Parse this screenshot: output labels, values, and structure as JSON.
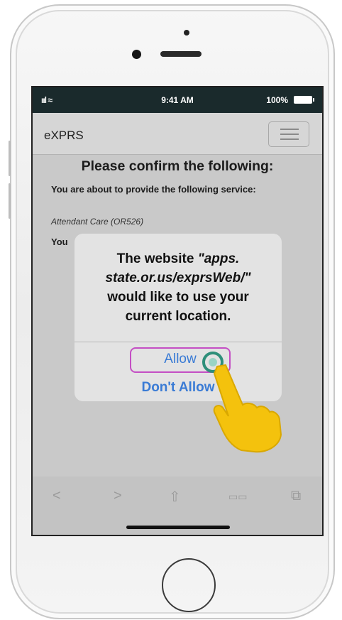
{
  "status_bar": {
    "signal": "ııl ≈",
    "time": "9:41 AM",
    "battery": "100%"
  },
  "navbar": {
    "brand": "eXPRS"
  },
  "page": {
    "title": "Please confirm the following:",
    "intro": "You are about to provide the following service:",
    "service": "Attendant Care (OR526)",
    "second_line_start": "You"
  },
  "dialog": {
    "message_1": "The website ",
    "message_url_1": "\"apps.",
    "message_url_2": "state.or.us/exprsWeb/\"",
    "message_2": "would like to use your",
    "message_3": "current location.",
    "allow_label": "Allow",
    "deny_label": "Don't Allow"
  },
  "toolbar": {
    "back": "<",
    "forward": ">",
    "share": "⇧",
    "bookmarks": "▭▭",
    "tabs": "⧉"
  },
  "colors": {
    "accent": "#3a7bd5",
    "highlight_border": "#c44fc4",
    "pointer": "#f4c20d"
  }
}
